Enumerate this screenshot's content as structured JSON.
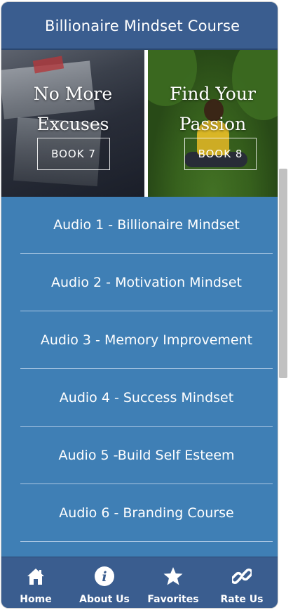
{
  "header": {
    "title": "Billionaire Mindset Course"
  },
  "books": [
    {
      "title_line1": "No More",
      "title_line2": "Excuses",
      "button": "BOOK 7"
    },
    {
      "title_line1": "Find Your",
      "title_line2": "Passion",
      "button": "BOOK 8"
    }
  ],
  "audio_list": [
    "Audio 1 - Billionaire Mindset",
    "Audio 2 - Motivation Mindset",
    "Audio 3 - Memory Improvement",
    "Audio 4 - Success Mindset",
    "Audio 5 -Build Self Esteem",
    "Audio 6 - Branding Course"
  ],
  "nav": [
    {
      "label": "Home",
      "icon": "home-icon"
    },
    {
      "label": "About Us",
      "icon": "info-icon"
    },
    {
      "label": "Favorites",
      "icon": "star-icon"
    },
    {
      "label": "Rate Us",
      "icon": "link-icon"
    }
  ],
  "colors": {
    "header": "#3a5d8f",
    "list_background": "#3f7fb5",
    "divider": "#a9c6e2"
  }
}
